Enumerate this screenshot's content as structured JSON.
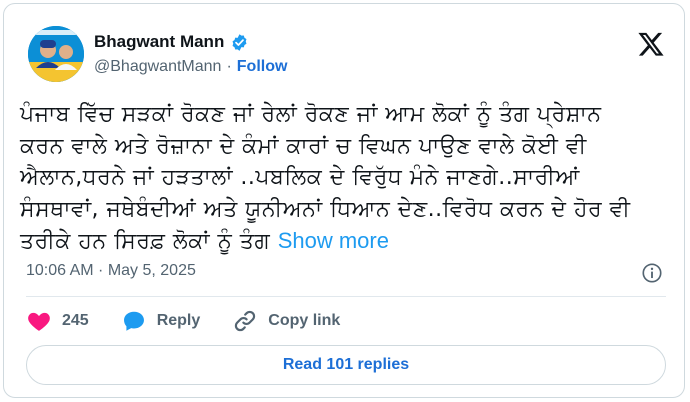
{
  "author": {
    "name": "Bhagwant Mann",
    "handle": "@BhagwantMann",
    "separator": "·",
    "follow_label": "Follow",
    "verified_color": "#1d9bf0",
    "avatar_icon": "person-avatar-icon"
  },
  "post": {
    "lines": [
      "ਪੰਜਾਬ ਵਿੱਚ ਸੜਕਾਂ ਰੋਕਣ ਜਾਂ ਰੇਲਾਂ ਰੋਕਣ ਜਾਂ ਆਮ ਲੋਕਾਂ ਨੂੰ ਤੰਗ ਪ੍ਰੇਸ਼ਾਨ",
      "ਕਰਨ ਵਾਲੇ ਅਤੇ ਰੋਜ਼ਾਨਾ ਦੇ ਕੰਮਾਂ ਕਾਰਾਂ ਚ ਵਿਘਨ ਪਾਉਣ ਵਾਲੇ ਕੋਈ ਵੀ",
      "ਐਲਾਨ,ਧਰਨੇ ਜਾਂ ਹੜਤਾਲਾਂ ..ਪਬਲਿਕ ਦੇ ਵਿਰੁੱਧ ਮੰਨੇ ਜਾਣਗੇ..ਸਾਰੀਆਂ",
      "ਸੰਸਥਾਵਾਂ, ਜਥੇਬੰਦੀਆਂ ਅਤੇ ਯੂਨੀਅਨਾਂ ਧਿਆਨ ਦੇਣ..ਵਿਰੋਧ ਕਰਨ ਦੇ ਹੋਰ ਵੀ",
      "ਤਰੀਕੇ ਹਨ ਸਿਰਫ਼ ਲੋਕਾਂ ਨੂੰ ਤੰਗ"
    ],
    "show_more": "Show more",
    "time": "10:06 AM · May 5, 2025"
  },
  "actions": {
    "like_count": "245",
    "reply_label": "Reply",
    "copy_link_label": "Copy link",
    "like_color": "#f91880",
    "reply_color": "#1d9bf0"
  },
  "replies_button": "Read 101 replies"
}
